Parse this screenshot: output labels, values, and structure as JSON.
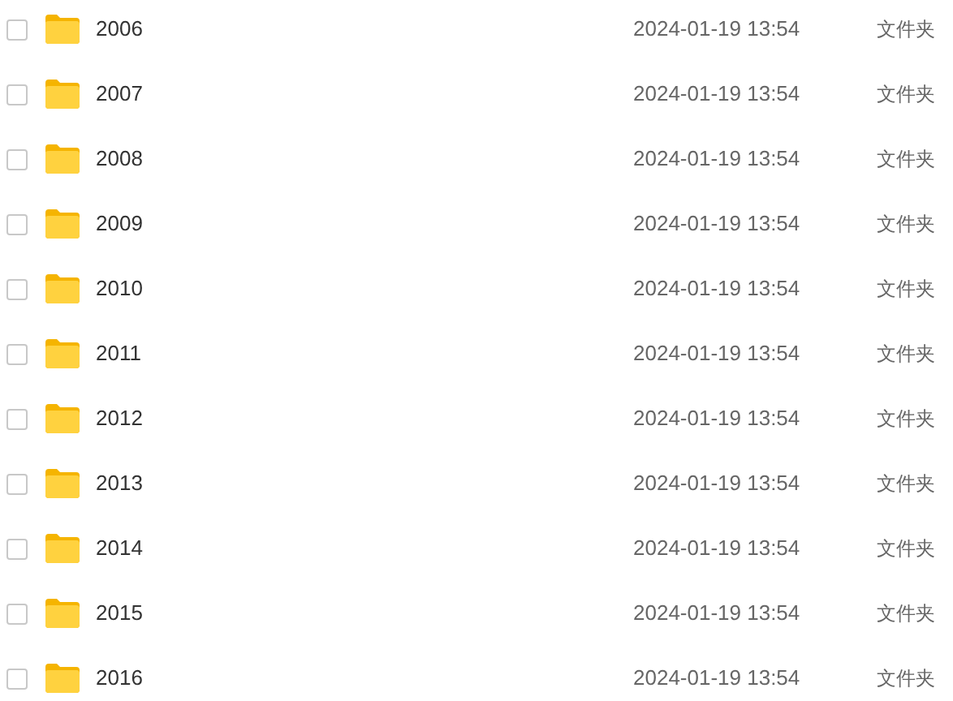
{
  "rows": [
    {
      "name": "2006",
      "date": "2024-01-19 13:54",
      "type": "文件夹",
      "checked": false
    },
    {
      "name": "2007",
      "date": "2024-01-19 13:54",
      "type": "文件夹",
      "checked": false
    },
    {
      "name": "2008",
      "date": "2024-01-19 13:54",
      "type": "文件夹",
      "checked": false
    },
    {
      "name": "2009",
      "date": "2024-01-19 13:54",
      "type": "文件夹",
      "checked": false
    },
    {
      "name": "2010",
      "date": "2024-01-19 13:54",
      "type": "文件夹",
      "checked": false
    },
    {
      "name": "2011",
      "date": "2024-01-19 13:54",
      "type": "文件夹",
      "checked": false
    },
    {
      "name": "2012",
      "date": "2024-01-19 13:54",
      "type": "文件夹",
      "checked": false
    },
    {
      "name": "2013",
      "date": "2024-01-19 13:54",
      "type": "文件夹",
      "checked": false
    },
    {
      "name": "2014",
      "date": "2024-01-19 13:54",
      "type": "文件夹",
      "checked": false
    },
    {
      "name": "2015",
      "date": "2024-01-19 13:54",
      "type": "文件夹",
      "checked": false
    },
    {
      "name": "2016",
      "date": "2024-01-19 13:54",
      "type": "文件夹",
      "checked": false
    }
  ]
}
